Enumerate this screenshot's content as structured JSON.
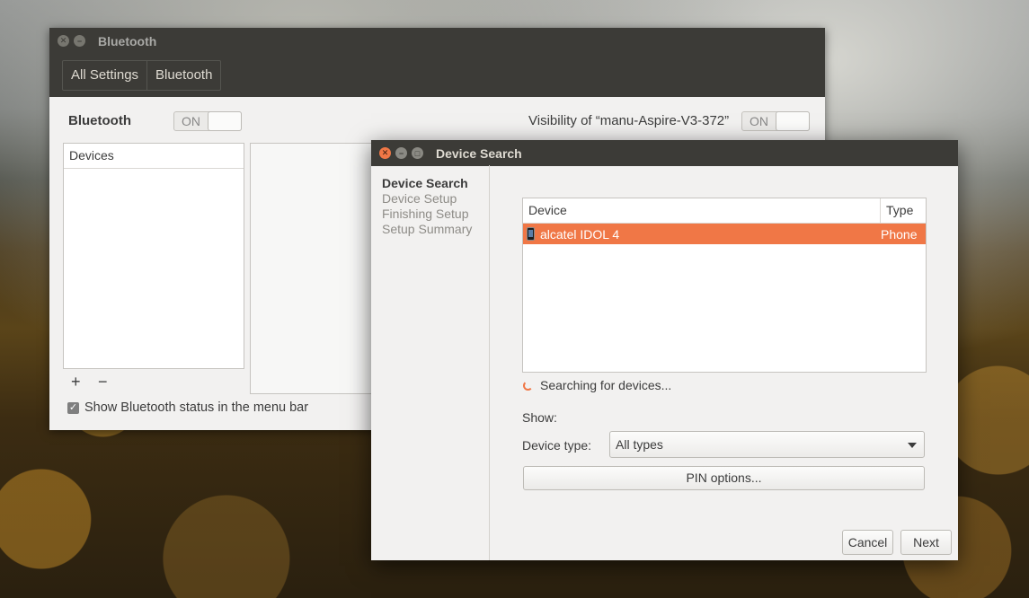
{
  "bluetooth_window": {
    "title": "Bluetooth",
    "breadcrumbs": [
      "All Settings",
      "Bluetooth"
    ],
    "bluetooth_label": "Bluetooth",
    "bluetooth_switch": "ON",
    "visibility_label": "Visibility of “manu-Aspire-V3-372”",
    "visibility_switch": "ON",
    "devices_header": "Devices",
    "add_symbol": "+",
    "remove_symbol": "−",
    "show_status_label": "Show Bluetooth status in the menu bar",
    "show_status_checked": true
  },
  "dialog": {
    "title": "Device Search",
    "steps": [
      "Device Search",
      "Device Setup",
      "Finishing Setup",
      "Setup Summary"
    ],
    "active_step": 0,
    "columns": {
      "device": "Device",
      "type": "Type"
    },
    "devices": [
      {
        "name": "alcatel IDOL 4",
        "type": "Phone",
        "icon": "phone-icon"
      }
    ],
    "status": "Searching for devices...",
    "show_label": "Show:",
    "device_type_label": "Device type:",
    "device_type_value": "All types",
    "pin_options": "PIN options...",
    "cancel": "Cancel",
    "next": "Next"
  },
  "colors": {
    "accent": "#f07746",
    "titlebar": "#3c3b37",
    "window_bg": "#f2f1f0"
  }
}
